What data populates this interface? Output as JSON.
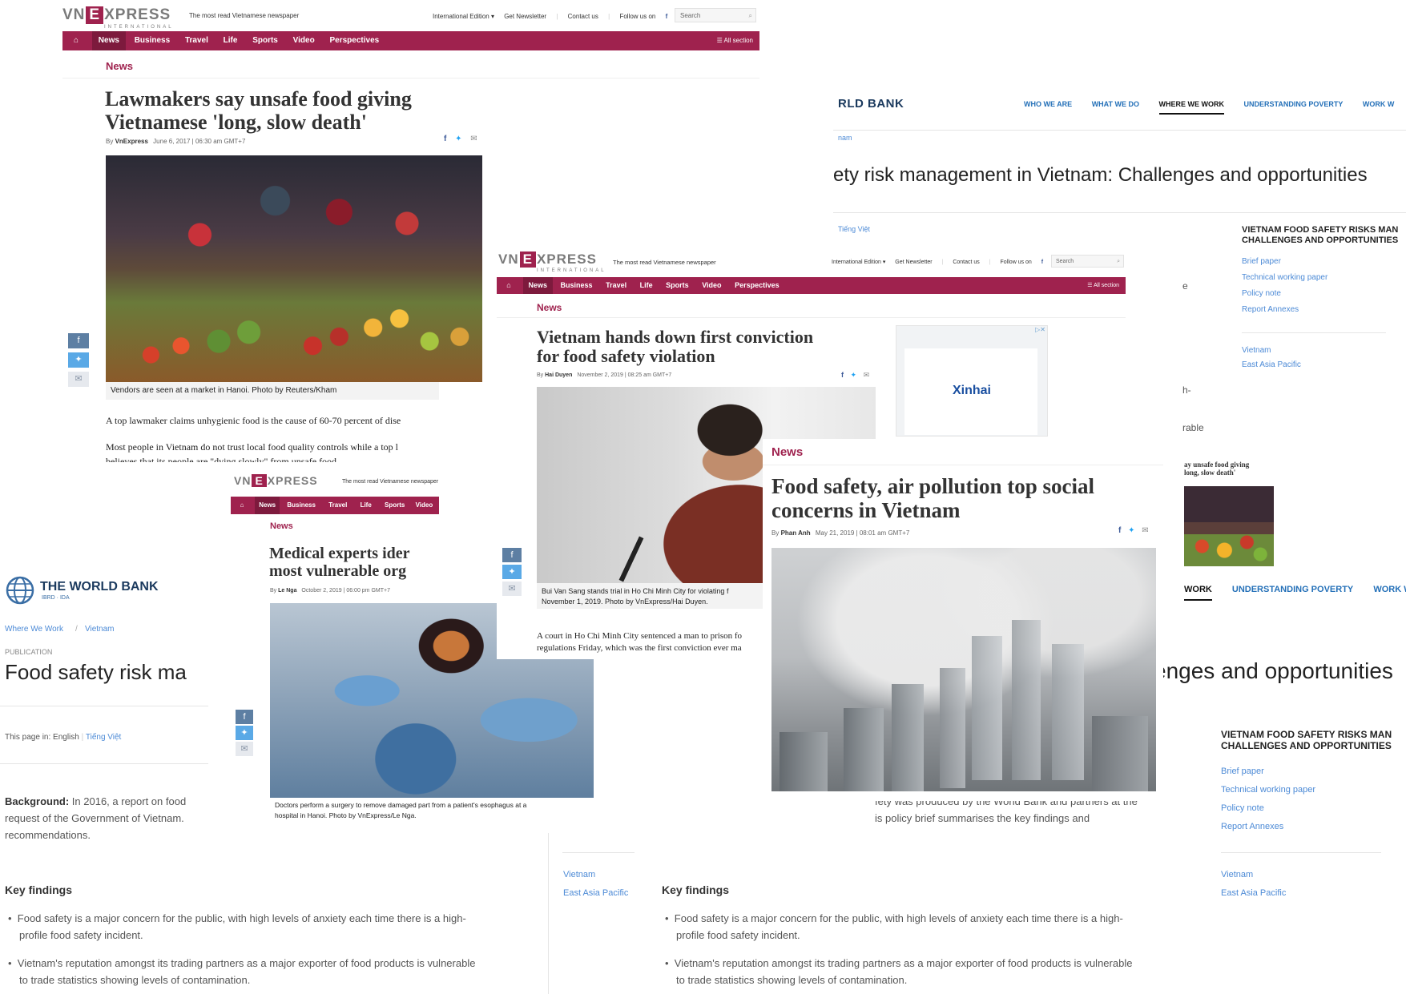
{
  "vn_header": {
    "logo_left": "VN",
    "logo_e": "E",
    "logo_right": "XPRESS",
    "logo_sub": "INTERNATIONAL",
    "tagline": "The most read Vietnamese newspaper",
    "intl_edition": "International Edition ▾",
    "newsletter": "Get Newsletter",
    "contact": "Contact us",
    "follow": "Follow us on",
    "fb": "f",
    "tw": "🐦",
    "search_placeholder": "Search",
    "home_icon": "⌂",
    "nav": [
      "News",
      "Business",
      "Travel",
      "Life",
      "Sports",
      "Video",
      "Perspectives"
    ],
    "all_section": "☰ All section",
    "category": "News"
  },
  "article1": {
    "title_line1": "Lawmakers say unsafe food giving",
    "title_line2": "Vietnamese 'long, slow death'",
    "byline_by": "By",
    "author": "VnExpress",
    "date": "June 6, 2017 | 06:30 am GMT+7",
    "caption": "Vendors are seen at a market in Hanoi. Photo by Reuters/Kham",
    "para1": "A top lawmaker claims unhygienic food is the cause of 60-70 percent of dise",
    "para2": "Most people in Vietnam do not trust local food quality controls while a top l",
    "para3": "believes that its people are \"dying slowly\" from unsafe food."
  },
  "article2": {
    "title_line1": "Vietnam hands down first conviction",
    "title_line2": "for food safety violation",
    "byline_by": "By",
    "author": "Hai Duyen",
    "date": "November 2, 2019 | 08:25 am GMT+7",
    "caption_line1": "Bui Van Sang stands trial in Ho Chi Minh City for violating f",
    "caption_line2": "November 1, 2019. Photo by VnExpress/Hai Duyen.",
    "para1": "A court in Ho Chi Minh City sentenced a man to prison fo",
    "para2": "regulations Friday, which was the first conviction ever ma",
    "ad_brand": "Xinhai"
  },
  "article3": {
    "title_line1": "Medical experts ider",
    "title_line2": "most vulnerable org",
    "byline_by": "By",
    "author": "Le Nga",
    "date": "October 2, 2019 | 06:00 pm GMT+7",
    "caption_line1": "Doctors perform a surgery to remove damaged part from a patient's esophagus at a",
    "caption_line2": "hospital in Hanoi. Photo by VnExpress/Le Nga."
  },
  "article4": {
    "category": "News",
    "title_line1": "Food safety, air pollution top social",
    "title_line2": "concerns in Vietnam",
    "byline_by": "By",
    "author": "Phan Anh",
    "date": "May 21, 2019 | 08:01 am GMT+7"
  },
  "worldbank": {
    "logo_text": "THE WORLD BANK",
    "logo_sub": "IBRD · IDA",
    "logo_partial": "RLD BANK",
    "nav": [
      "WHO WE ARE",
      "WHAT WE DO",
      "WHERE WE WORK",
      "UNDERSTANDING POVERTY",
      "WORK W"
    ],
    "nav_partial": [
      "WORK",
      "UNDERSTANDING POVERTY",
      "WORK W"
    ],
    "breadcrumb_partial": "nam",
    "breadcrumb_1": "Where We Work",
    "breadcrumb_sep": "/",
    "breadcrumb_2": "Vietnam",
    "pub_label": "PUBLICATION",
    "title_partial_top": "ety risk management in Vietnam: Challenges and opportunities",
    "title_left": "Food safety risk ma",
    "title_partial_bottom": "enges and opportunities",
    "lang_prefix": "This page in:",
    "lang_en": "English",
    "lang_vi": "Tiếng Việt",
    "side_heading_1": "VIETNAM FOOD SAFETY RISKS MAN",
    "side_heading_2": "CHALLENGES AND OPPORTUNITIES",
    "side_links": [
      "Brief paper",
      "Technical working paper",
      "Policy note",
      "Report Annexes"
    ],
    "regions": [
      "Vietnam",
      "East Asia Pacific"
    ],
    "background_label": "Background:",
    "background_text_1": "In 2016, a report on food",
    "background_text_2": "request of the Government of Vietnam.",
    "background_text_3": "recommendations.",
    "bg_right_1": "fety was produced by the World Bank and partners at the",
    "bg_right_2": "is policy brief summarises the key findings and",
    "key_findings": "Key findings",
    "finding_1a": "Food safety is a major concern for the public, with high levels of anxiety each time there is a high-",
    "finding_1b": "profile food safety incident.",
    "finding_2a": "Vietnam's reputation amongst its trading partners as a major exporter of food products is vulnerable",
    "finding_2b": "to trade statistics showing levels of contamination.",
    "frag_e": "e",
    "frag_h": "h-",
    "frag_rable": "rable",
    "thumb_title_1": "ay unsafe food giving",
    "thumb_title_2": "long, slow death'"
  },
  "colors": {
    "vn_red": "#9f224e",
    "wb_blue": "#2470b8",
    "link_blue": "#4c8ad6"
  }
}
